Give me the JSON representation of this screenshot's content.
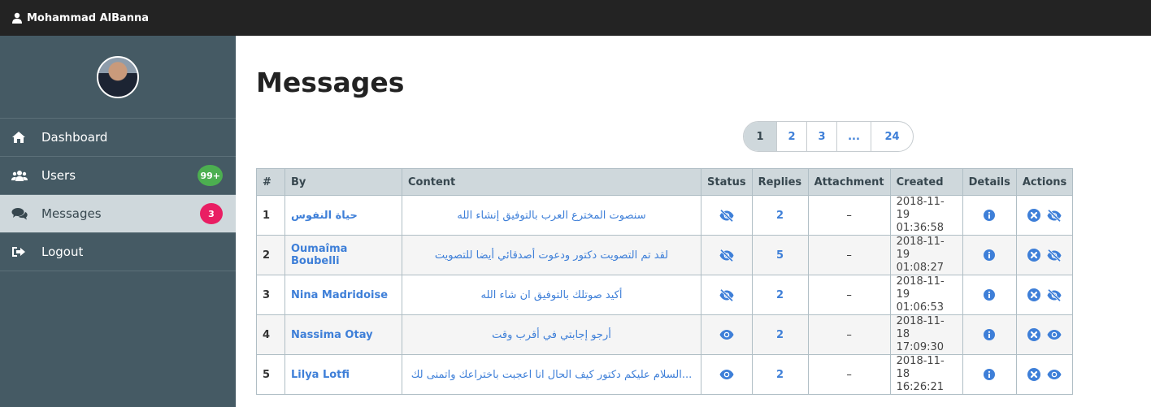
{
  "header": {
    "username": "Mohammad AlBanna"
  },
  "sidebar": {
    "items": [
      {
        "label": "Dashboard",
        "icon": "home-icon",
        "active": false
      },
      {
        "label": "Users",
        "icon": "users-icon",
        "active": false,
        "badge": "99+"
      },
      {
        "label": "Messages",
        "icon": "comments-icon",
        "active": true,
        "badge": "3"
      },
      {
        "label": "Logout",
        "icon": "sign-out-icon",
        "active": false
      }
    ]
  },
  "main": {
    "title": "Messages",
    "pagination": [
      "1",
      "2",
      "3",
      "...",
      "24"
    ],
    "table": {
      "headers": [
        "#",
        "By",
        "Content",
        "Status",
        "Replies",
        "Attachment",
        "Created",
        "Details",
        "Actions"
      ],
      "rows": [
        {
          "num": "1",
          "by": "حياة النفوس",
          "content": "سنصوت المخترع العرب بالتوفيق إنشاء الله",
          "status": "eye-slash-icon",
          "replies": "2",
          "attachment": "–",
          "created_date": "2018-11-19",
          "created_time": "01:36:58",
          "action_toggle": "eye-slash-icon"
        },
        {
          "num": "2",
          "by": "Oumaîma Boubelli",
          "content": "لقد تم التصويت دكتور ودعوت أصدقائي أيضا للتصويت",
          "status": "eye-slash-icon",
          "replies": "5",
          "attachment": "–",
          "created_date": "2018-11-19",
          "created_time": "01:08:27",
          "action_toggle": "eye-slash-icon"
        },
        {
          "num": "3",
          "by": "Nina Madridoise",
          "content": "أكيد صوتلك بالتوفيق ان شاء الله",
          "status": "eye-slash-icon",
          "replies": "2",
          "attachment": "–",
          "created_date": "2018-11-19",
          "created_time": "01:06:53",
          "action_toggle": "eye-slash-icon"
        },
        {
          "num": "4",
          "by": "Nassima Otay",
          "content": "أرجو إجابتي في أقرب وقت",
          "status": "eye-icon",
          "replies": "2",
          "attachment": "–",
          "created_date": "2018-11-18",
          "created_time": "17:09:30",
          "action_toggle": "eye-icon"
        },
        {
          "num": "5",
          "by": "Lilya Lotfi",
          "content": "السلام عليكم دكتور كيف الحال انا اعجبت باختراعك واتمنى لك...",
          "status": "eye-icon",
          "replies": "2",
          "attachment": "–",
          "created_date": "2018-11-18",
          "created_time": "16:26:21",
          "action_toggle": "eye-icon"
        }
      ]
    }
  },
  "colors": {
    "topbar": "#232323",
    "sidebar": "#455a64",
    "active": "#cfd8dc",
    "link": "#3e7fd8",
    "badge_green": "#4caf50",
    "badge_red": "#e91e63"
  }
}
